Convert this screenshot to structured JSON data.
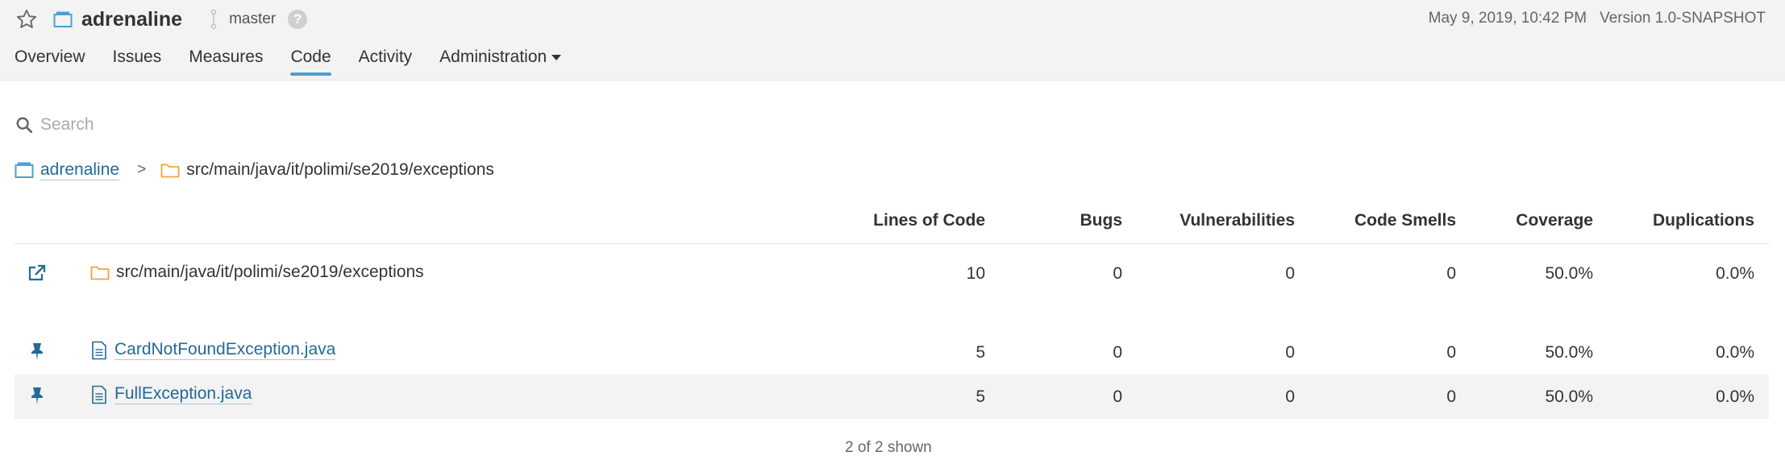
{
  "header": {
    "project_name": "adrenaline",
    "branch": "master",
    "help": "?",
    "date": "May 9, 2019, 10:42 PM",
    "version": "Version 1.0-SNAPSHOT"
  },
  "nav": {
    "tabs": [
      {
        "label": "Overview"
      },
      {
        "label": "Issues"
      },
      {
        "label": "Measures"
      },
      {
        "label": "Code",
        "active": true
      },
      {
        "label": "Activity"
      },
      {
        "label": "Administration"
      }
    ]
  },
  "search": {
    "placeholder": "Search"
  },
  "breadcrumb": {
    "project": "adrenaline",
    "separator": ">",
    "path": "src/main/java/it/polimi/se2019/exceptions"
  },
  "table": {
    "columns": [
      "Lines of Code",
      "Bugs",
      "Vulnerabilities",
      "Code Smells",
      "Coverage",
      "Duplications"
    ],
    "base_row": {
      "name": "src/main/java/it/polimi/se2019/exceptions",
      "values": [
        "10",
        "0",
        "0",
        "0",
        "50.0%",
        "0.0%"
      ]
    },
    "files": [
      {
        "name": "CardNotFoundException.java",
        "values": [
          "5",
          "0",
          "0",
          "0",
          "50.0%",
          "0.0%"
        ]
      },
      {
        "name": "FullException.java",
        "values": [
          "5",
          "0",
          "0",
          "0",
          "50.0%",
          "0.0%"
        ]
      }
    ]
  },
  "footer": {
    "shown": "2 of 2 shown"
  },
  "colors": {
    "accent": "#4b9fd5",
    "link": "#236a97",
    "folder": "#f0a43c",
    "project_icon": "#4b9fd5"
  },
  "icons": [
    "star-icon",
    "project-icon",
    "branch-icon",
    "help-icon",
    "search-icon",
    "folder-icon",
    "open-component-icon",
    "pin-icon",
    "file-icon"
  ]
}
